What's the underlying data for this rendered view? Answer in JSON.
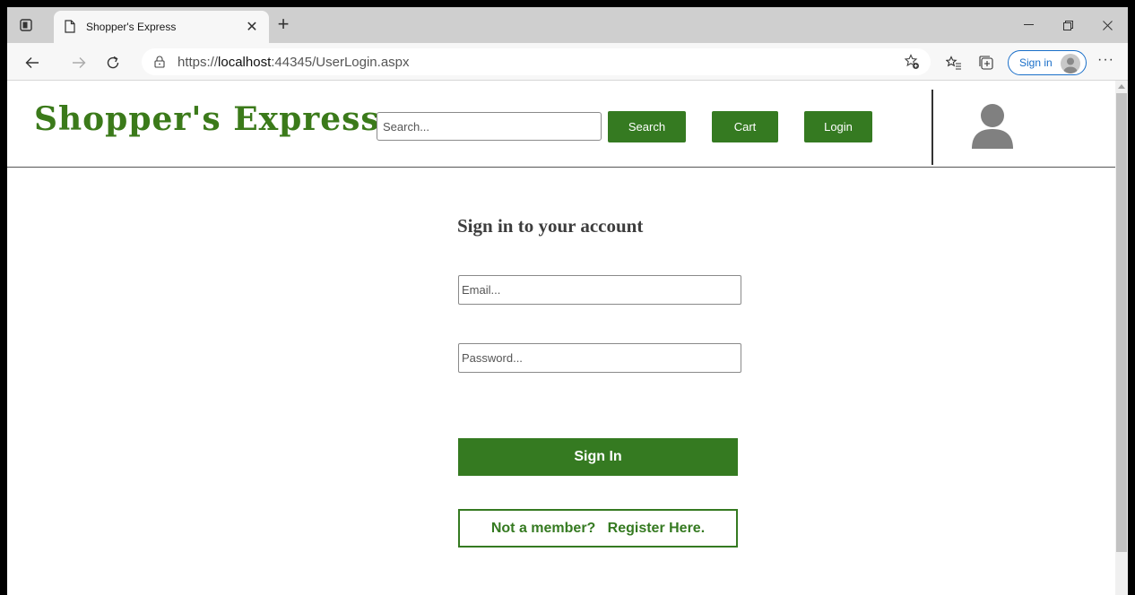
{
  "browser": {
    "tab_title": "Shopper's Express",
    "url_prefix": "https://",
    "url_host": "localhost",
    "url_rest": ":44345/UserLogin.aspx",
    "profile_label": "Sign in",
    "more_label": "···"
  },
  "header": {
    "logo_text": "Shopper's Express",
    "search_placeholder": "Search...",
    "search_button": "Search",
    "cart_button": "Cart",
    "login_button": "Login"
  },
  "login_form": {
    "title": "Sign in to your account",
    "email_placeholder": "Email...",
    "password_placeholder": "Password...",
    "signin_button": "Sign In",
    "register_button": "Not a member?   Register Here."
  },
  "colors": {
    "brand_green": "#357a21",
    "logo_green": "#3b7a1a",
    "link_blue": "#1a6fc9"
  },
  "icons": [
    "tab-actions-icon",
    "page-icon",
    "close-icon",
    "plus-icon",
    "minimize-icon",
    "restore-icon",
    "window-close-icon",
    "back-icon",
    "forward-icon",
    "refresh-icon",
    "lock-icon",
    "add-favorite-icon",
    "favorites-icon",
    "collections-icon",
    "user-avatar-icon"
  ]
}
